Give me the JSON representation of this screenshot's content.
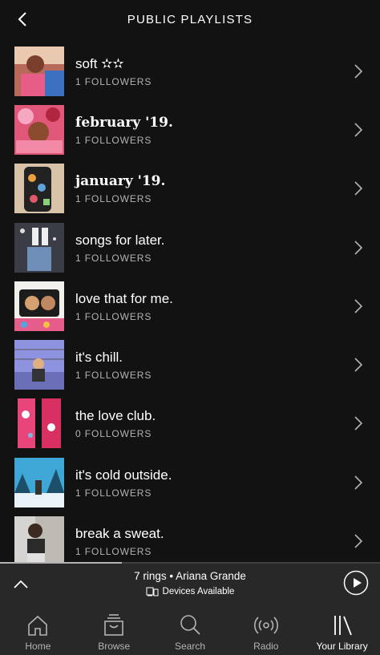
{
  "header": {
    "title": "PUBLIC PLAYLISTS"
  },
  "playlists": [
    {
      "name": "soft ✫✫",
      "followers": "1 FOLLOWERS",
      "serif": false
    },
    {
      "name": "february '19.",
      "followers": "1 FOLLOWERS",
      "serif": true
    },
    {
      "name": "january '19.",
      "followers": "1 FOLLOWERS",
      "serif": true
    },
    {
      "name": "songs for later.",
      "followers": "1 FOLLOWERS",
      "serif": false
    },
    {
      "name": "love that for me.",
      "followers": "1 FOLLOWERS",
      "serif": false
    },
    {
      "name": "it's chill.",
      "followers": "1 FOLLOWERS",
      "serif": false
    },
    {
      "name": "the love club.",
      "followers": "0 FOLLOWERS",
      "serif": false
    },
    {
      "name": "it's cold outside.",
      "followers": "1 FOLLOWERS",
      "serif": false
    },
    {
      "name": "break a sweat.",
      "followers": "1 FOLLOWERS",
      "serif": false
    }
  ],
  "player": {
    "track": "7 rings • Ariana Grande",
    "devices": "Devices Available",
    "progress": 0.32
  },
  "tabs": [
    {
      "label": "Home",
      "icon": "home-icon"
    },
    {
      "label": "Browse",
      "icon": "browse-icon"
    },
    {
      "label": "Search",
      "icon": "search-icon"
    },
    {
      "label": "Radio",
      "icon": "radio-icon"
    },
    {
      "label": "Your Library",
      "icon": "library-icon",
      "active": true
    }
  ],
  "colors": {
    "background": "#121212",
    "player": "#282828",
    "secondary_text": "#b3b3b3"
  }
}
